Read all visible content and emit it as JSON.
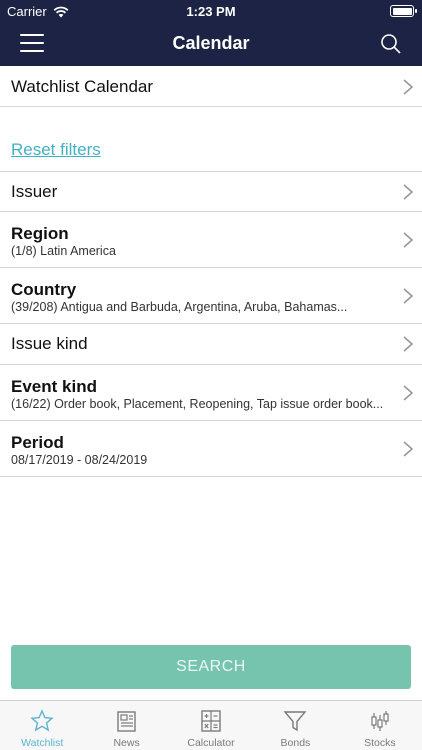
{
  "status_bar": {
    "carrier": "Carrier",
    "time": "1:23 PM"
  },
  "nav": {
    "title": "Calendar"
  },
  "watchlist_row": {
    "label": "Watchlist Calendar"
  },
  "reset_filters": "Reset filters",
  "filters": [
    {
      "title": "Issuer",
      "subtitle": null
    },
    {
      "title": "Region",
      "subtitle": "(1/8) Latin America"
    },
    {
      "title": "Country",
      "subtitle": "(39/208) Antigua and Barbuda, Argentina, Aruba, Bahamas..."
    },
    {
      "title": "Issue kind",
      "subtitle": null
    },
    {
      "title": "Event kind",
      "subtitle": "(16/22) Order book, Placement, Reopening, Tap issue order book..."
    },
    {
      "title": "Period",
      "subtitle": "08/17/2019 - 08/24/2019"
    }
  ],
  "search_button": "SEARCH",
  "tabs": [
    {
      "label": "Watchlist",
      "icon": "star-icon",
      "active": true
    },
    {
      "label": "News",
      "icon": "newspaper-icon",
      "active": false
    },
    {
      "label": "Calculator",
      "icon": "calculator-icon",
      "active": false
    },
    {
      "label": "Bonds",
      "icon": "filter-icon",
      "active": false
    },
    {
      "label": "Stocks",
      "icon": "candlestick-icon",
      "active": false
    }
  ],
  "colors": {
    "header_bg": "#1c2345",
    "link": "#44b0c4",
    "button_bg": "#77c4ae",
    "tab_active": "#5fb3cf",
    "tab_inactive": "#7a7a7a"
  }
}
